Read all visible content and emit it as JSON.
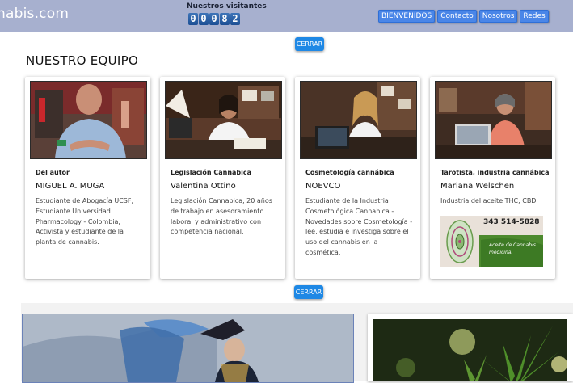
{
  "site": {
    "title": "nabis.com"
  },
  "visitors": {
    "label": "Nuestros visitantes",
    "digits": [
      "0",
      "0",
      "0",
      "8",
      "2"
    ]
  },
  "nav": {
    "items": [
      "BIENVENIDOS",
      "Contacto",
      "Nosotros",
      "Redes"
    ]
  },
  "buttons": {
    "close_label": "CERRAR"
  },
  "team": {
    "title": "NUESTRO EQUIPO",
    "members": [
      {
        "role": "Del autor",
        "name": "MIGUEL A. MUGA",
        "description": "Estudiante de Abogacía UCSF, Estudiante Universidad Pharmacology - Colombia, Activista y estudiante de la planta de cannabis."
      },
      {
        "role": "Legislación Cannabica",
        "name": "Valentina Ottino",
        "description": "Legislación Cannabica, 20 años de trabajo en asesoramiento laboral y administrativo con competencia nacional."
      },
      {
        "role": "Cosmetología cannábica",
        "name": "NOEVCO",
        "description": "Estudiante de la Industria Cosmetológica Cannabica - Novedades sobre Cosmetología - lee, estudia e investiga sobre el uso del cannabis en la cosmética."
      },
      {
        "role": "Tarotista, industria cannábica",
        "name": "Mariana Welschen",
        "description": "Industria del aceite THC, CBD"
      }
    ]
  },
  "ad": {
    "phone": "343 514-5828",
    "text": "Aceite de Cannabis medicinal"
  },
  "colors": {
    "topbar": "#a7b0cf",
    "button": "#1e88e5",
    "nav": "#4a86e8"
  }
}
